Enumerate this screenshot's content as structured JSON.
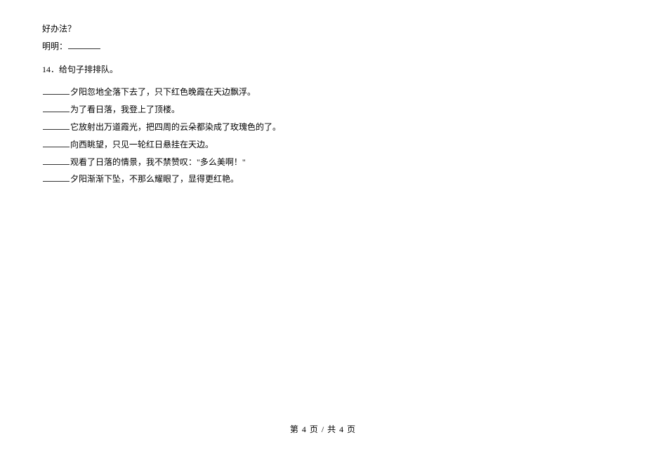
{
  "intro": {
    "line1": "好办法？",
    "line2_prefix": "明明："
  },
  "q14": {
    "number": "14．",
    "prompt": "给句子排排队。",
    "items": [
      "夕阳忽地全落下去了，只下红色晚霞在天边飘浮。",
      "为了看日落，我登上了顶楼。",
      "它放射出万道霞光，把四周的云朵都染成了玫瑰色的了。",
      "向西眺望，只见一轮红日悬挂在天边。",
      "观看了日落的情景，我不禁赞叹：\"多么美啊！\"",
      "夕阳渐渐下坠，不那么耀眼了，显得更红艳。"
    ]
  },
  "footer": {
    "text": "第 4 页  /  共 4 页"
  }
}
